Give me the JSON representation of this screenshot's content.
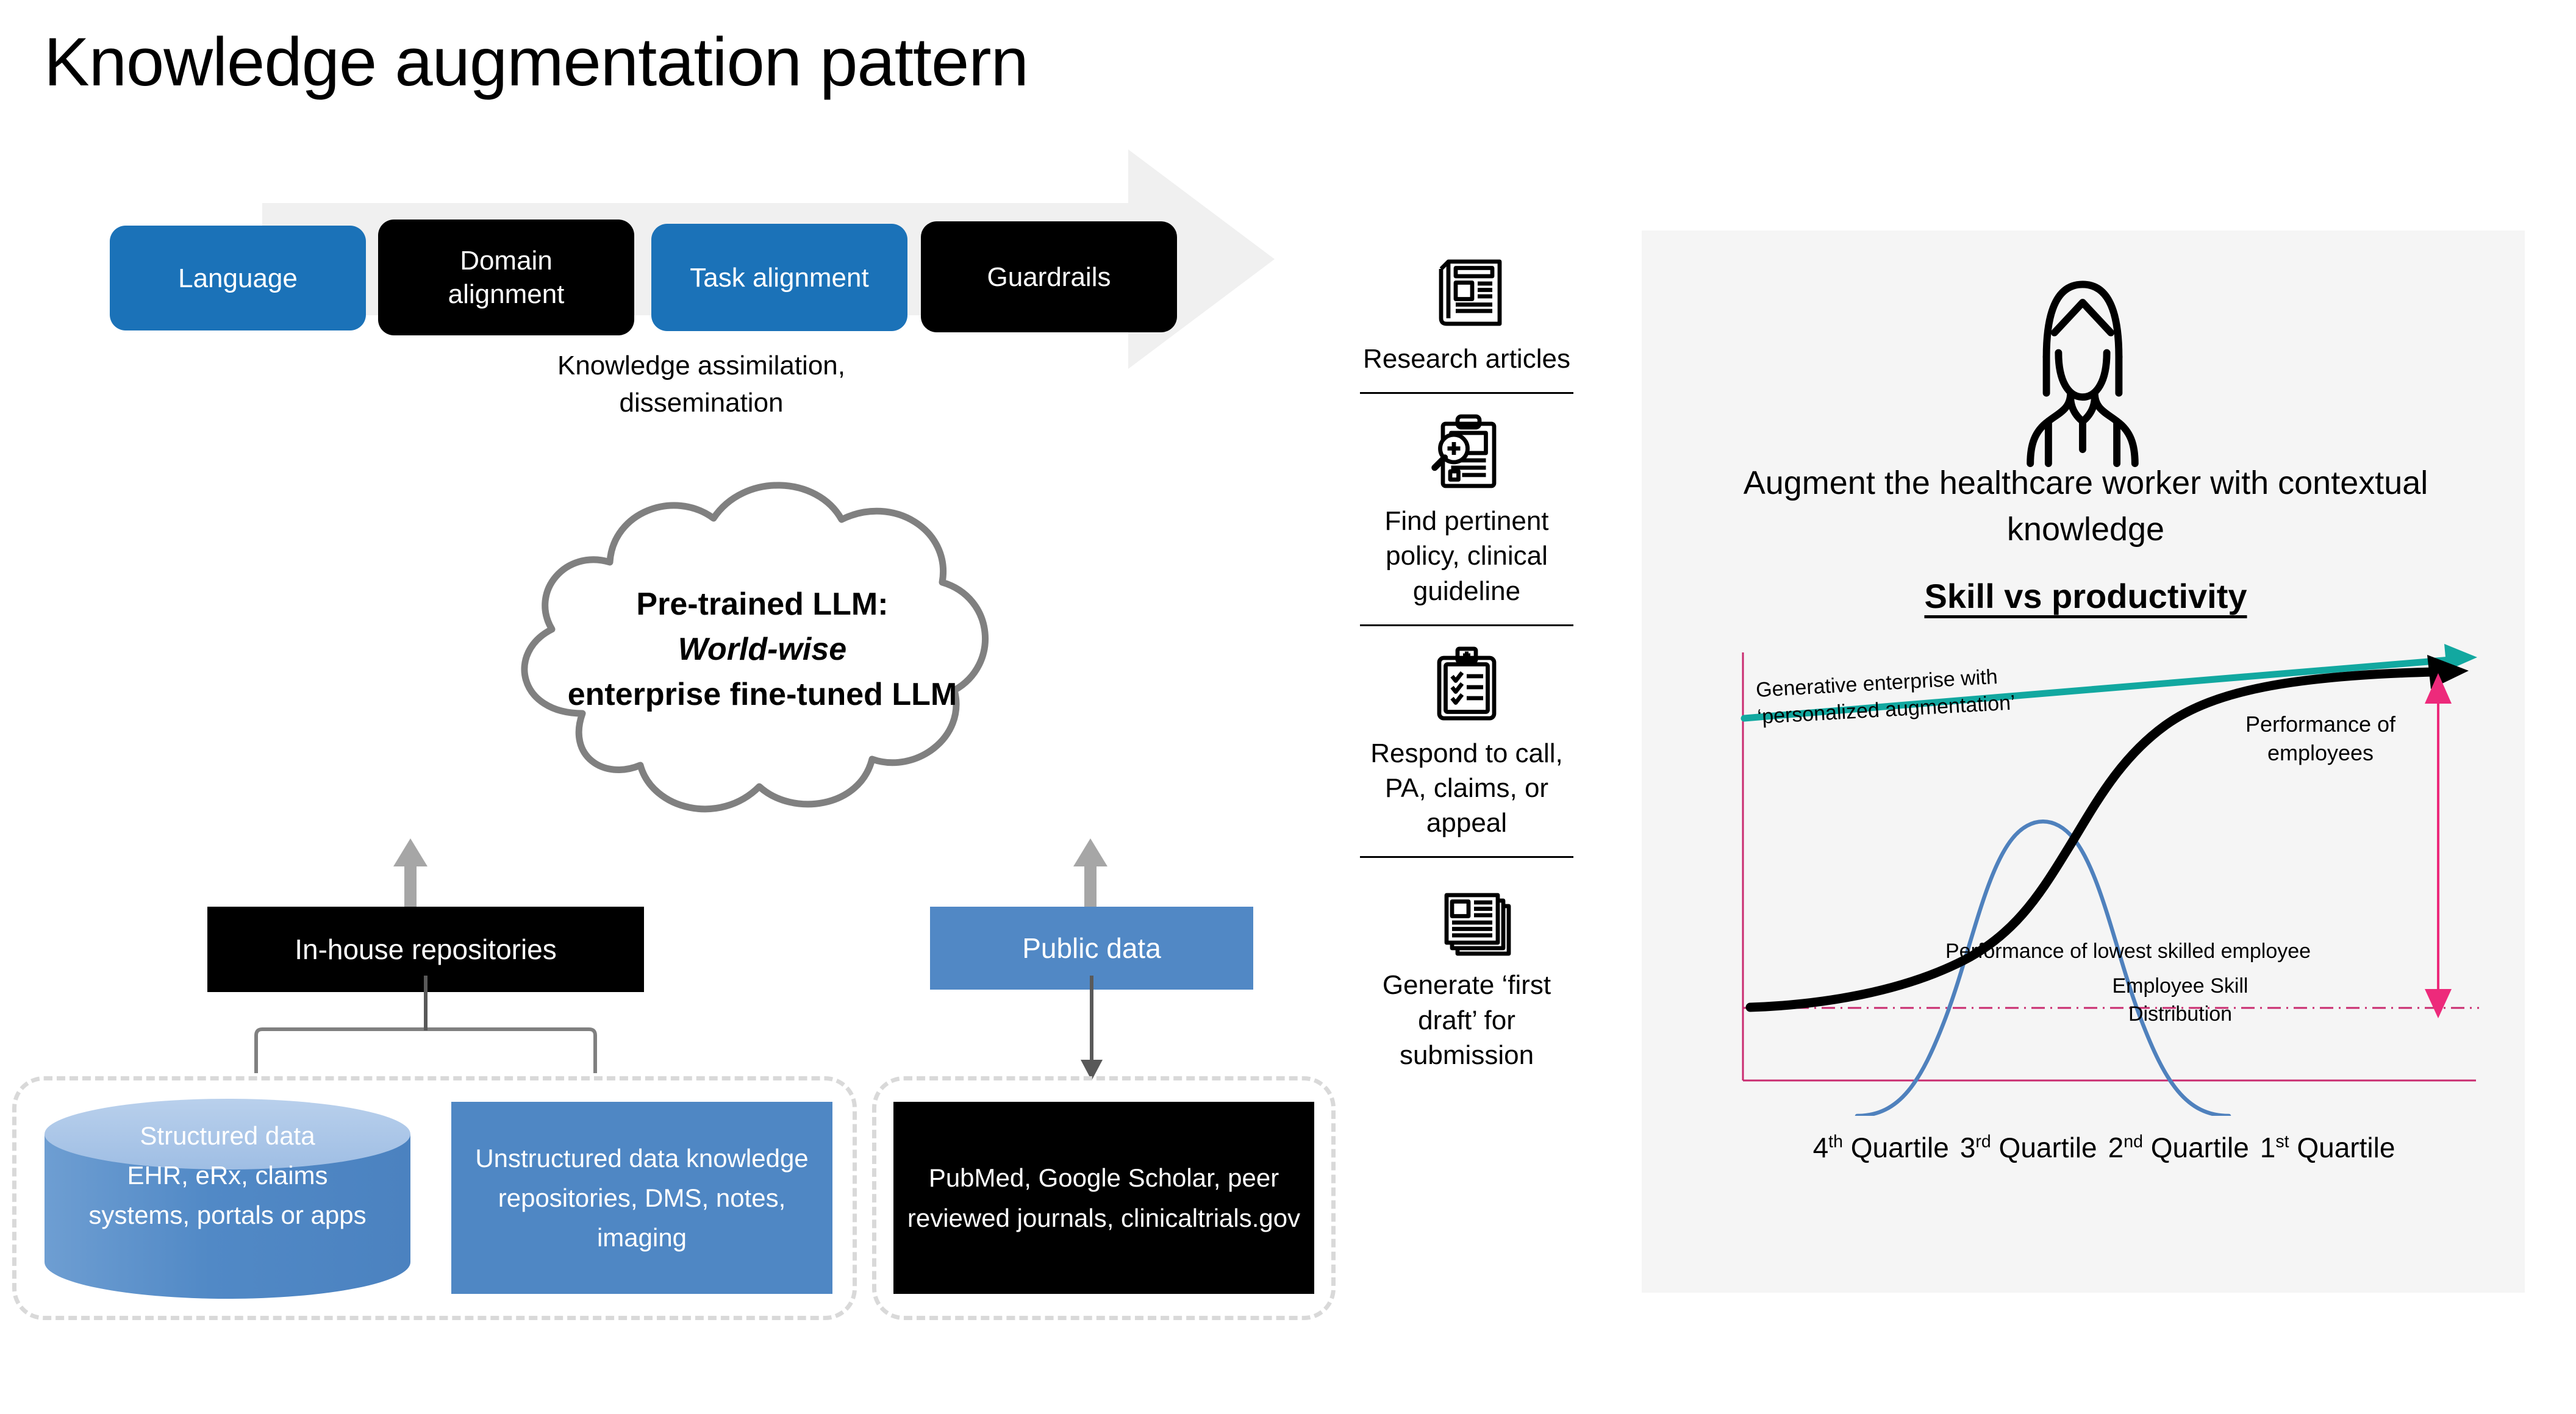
{
  "title": "Knowledge augmentation pattern",
  "pipeline": {
    "stages": [
      {
        "label": "Language",
        "color": "#1B72B8"
      },
      {
        "label": "Domain\nalignment",
        "color": "#000000"
      },
      {
        "label": "Task alignment",
        "color": "#1B72B8"
      },
      {
        "label": "Guardrails",
        "color": "#000000"
      }
    ],
    "caption": "Knowledge assimilation,\ndissemination",
    "arrow_color": "#F0F0F0"
  },
  "cloud": {
    "line1": "Pre-trained LLM:",
    "line2_italic": "World-wise",
    "line3": "enterprise fine-tuned LLM",
    "outline_color": "#808080"
  },
  "sources": {
    "inhouse_label": "In-house repositories",
    "public_label": "Public data",
    "structured_label": "Structured data\nEHR, eRx, claims\nsystems, portals or apps",
    "unstructured_label": "Unstructured data knowledge repositories, DMS, notes, imaging",
    "public_sources_label": "PubMed, Google Scholar, peer reviewed journals, clinicaltrials.gov",
    "blue": "#5188C5",
    "dashed_border": "#D9D9D9"
  },
  "use_cases": [
    {
      "icon": "newspaper-icon",
      "label": "Research articles"
    },
    {
      "icon": "clipboard-search-icon",
      "label": "Find pertinent policy, clinical guideline"
    },
    {
      "icon": "clipboard-checklist-icon",
      "label": "Respond to call, PA, claims, or appeal"
    },
    {
      "icon": "document-stack-icon",
      "label": "Generate ‘first draft’ for submission"
    }
  ],
  "right_panel": {
    "worker_icon": "healthcare-worker-icon",
    "caption": "Augment the healthcare worker with contextual knowledge",
    "chart_title": "Skill vs productivity",
    "background": "#F5F5F5"
  },
  "chart_data": {
    "type": "line",
    "title": "Skill vs productivity",
    "xlabel": "",
    "ylabel": "",
    "grid": false,
    "legend": "inline-annotations",
    "axis_color": "#C92A6E",
    "categories": [
      "4th Quartile",
      "3rd Quartile",
      "2nd Quartile",
      "1st Quartile"
    ],
    "tick_labels": [
      "4th Quartile",
      "3rd Quartile",
      "2nd Quartile",
      "1st Quartile"
    ],
    "xlim": [
      0,
      100
    ],
    "ylim": [
      0,
      100
    ],
    "series": [
      {
        "name": "Performance of employees",
        "type": "line",
        "color": "#000000",
        "width": 14,
        "x": [
          0,
          10,
          20,
          30,
          40,
          50,
          55,
          60,
          65,
          70,
          75,
          80,
          85,
          90,
          95,
          100
        ],
        "y": [
          8,
          9,
          11,
          14,
          19,
          27,
          33,
          41,
          52,
          63,
          72,
          79,
          84,
          87,
          89,
          90
        ]
      },
      {
        "name": "Employee Skill Distribution",
        "type": "line",
        "color": "#4F81BD",
        "width": 5,
        "x": [
          10,
          20,
          30,
          40,
          45,
          50,
          55,
          60,
          65,
          70,
          80,
          90,
          100
        ],
        "y": [
          0,
          4,
          14,
          38,
          51,
          57,
          54,
          44,
          30,
          18,
          5,
          1,
          0
        ]
      },
      {
        "name": "Generative enterprise with 'personalized augmentation'",
        "type": "arrow",
        "color": "#12A8A0",
        "width": 10,
        "x": [
          1,
          100
        ],
        "y": [
          86,
          96
        ]
      },
      {
        "name": "Performance gap",
        "type": "double-arrow",
        "color": "#ED2A7B",
        "width": 4,
        "x": [
          98,
          98
        ],
        "y": [
          90,
          8
        ]
      },
      {
        "name": "Performance of lowest skilled employee",
        "type": "dash-dot-baseline",
        "color": "#C92A6E",
        "width": 3,
        "x": [
          0,
          100
        ],
        "y": [
          8,
          8
        ]
      }
    ],
    "annotations": [
      {
        "text": "Generative enterprise with ‘personalized augmentation’",
        "anchor": "upper-left",
        "rotate": -3.2
      },
      {
        "text": "Performance of employees",
        "anchor": "upper-right"
      },
      {
        "text": "Performance of lowest skilled employee",
        "anchor": "baseline-mid"
      },
      {
        "text": "Employee Skill Distribution",
        "anchor": "lower-mid"
      }
    ]
  }
}
